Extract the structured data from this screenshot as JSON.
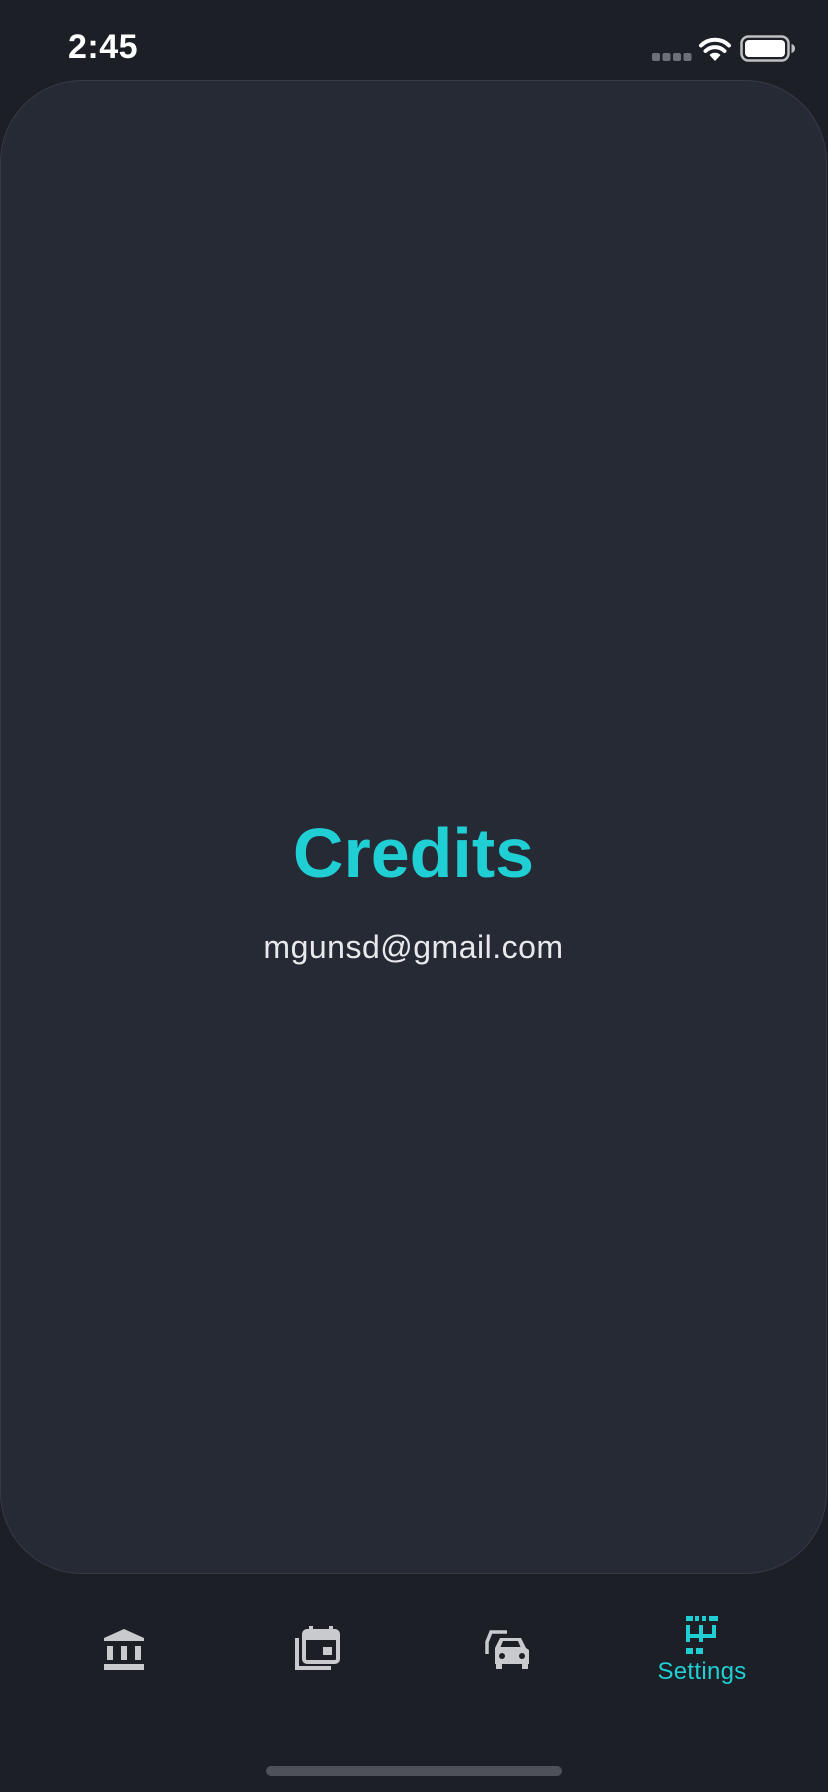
{
  "status_bar": {
    "time": "2:45"
  },
  "content": {
    "title": "Credits",
    "email": "mgunsd@gmail.com"
  },
  "tab_bar": {
    "tabs": [
      {
        "icon": "bank-icon",
        "label": "",
        "active": false
      },
      {
        "icon": "calendar-gallery-icon",
        "label": "",
        "active": false
      },
      {
        "icon": "cars-icon",
        "label": "",
        "active": false
      },
      {
        "icon": "settings-pixel-icon",
        "label": "Settings",
        "active": true
      }
    ]
  },
  "colors": {
    "background": "#1c1f26",
    "card": "#262a35",
    "accent": "#1fcfd4",
    "icon_inactive": "#c9cacd",
    "text": "#e8e9ec"
  }
}
